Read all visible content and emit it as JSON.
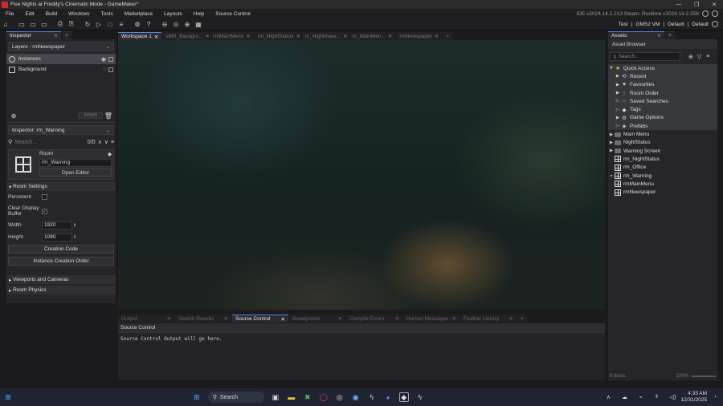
{
  "window": {
    "title": "Five Nights at Freddy's Cinematic Mode - GameMaker*",
    "controls": [
      "—",
      "❐",
      "✕"
    ]
  },
  "menu": {
    "items": [
      "File",
      "Edit",
      "Build",
      "Windows",
      "Tools",
      "Marketplace",
      "Layouts",
      "Help",
      "Source Control"
    ],
    "ide_version": "IDE v2024.14.2.213 Steam: Runtime v2024.14.2.256"
  },
  "toolbar": {
    "target": "Test",
    "vm": "GMS2 VM",
    "config1": "Default",
    "config2": "Default"
  },
  "inspector_top": {
    "tab": "Inspector",
    "layers_dropdown": "Layers - rmNewspaper",
    "layers": [
      {
        "name": "Instances",
        "selected": true
      },
      {
        "name": "Background",
        "selected": false
      }
    ],
    "inherit_label": "Inherit"
  },
  "inspector_bottom": {
    "dropdown": "Inspector: rm_Warning",
    "search_placeholder": "Search...",
    "match_count": "0/0",
    "asset_type": "Room",
    "asset_name": "rm_Warning",
    "open_editor": "Open Editor",
    "room_settings": "Room Settings",
    "persistent_label": "Persistent",
    "clear_display_label": "Clear Display Buffer",
    "width_label": "Width",
    "width_value": "1920",
    "height_label": "Height",
    "height_value": "1080",
    "creation_code": "Creation Code",
    "instance_order": "Instance Creation Order",
    "viewports": "Viewports and Cameras",
    "physics": "Room Physics"
  },
  "workspace": {
    "tabs": [
      "Workspace 1",
      "sMR_Backgro...",
      "rmMainMenu",
      "rm_NightStatus",
      "rc_Nightmare...",
      "rc_MainMen...",
      "rmNewspaper"
    ]
  },
  "output": {
    "tabs": [
      "Output",
      "Search Results",
      "Source Control",
      "Breakpoints",
      "Compile Errors",
      "Human Messages",
      "Feather Library"
    ],
    "header": "Source Control",
    "message": "Source Control Output will go here."
  },
  "assets": {
    "tab": "Assets",
    "browser_title": "Asset Browser",
    "search_placeholder": "Search...",
    "quick_access": "Quick Access",
    "quick_items": [
      "Recent",
      "Favourites",
      "Room Order",
      "Saved Searches",
      "Tags",
      "Game Options",
      "Prefabs"
    ],
    "quick_icons": [
      "⟲",
      "♥",
      "⋮",
      "○",
      "◆",
      "⚙",
      "◈"
    ],
    "folders": [
      "Main Menu",
      "NightStatus",
      "Warning Screen"
    ],
    "rooms": [
      "rm_NightStatus",
      "rm_Office",
      "rm_Warning",
      "rmMainMenu",
      "rmNewspaper"
    ],
    "footer_items": "8 Items",
    "footer_zoom": "100%"
  },
  "taskbar": {
    "search_label": "Search",
    "time": "4:33 AM",
    "date": "12/31/2025"
  }
}
